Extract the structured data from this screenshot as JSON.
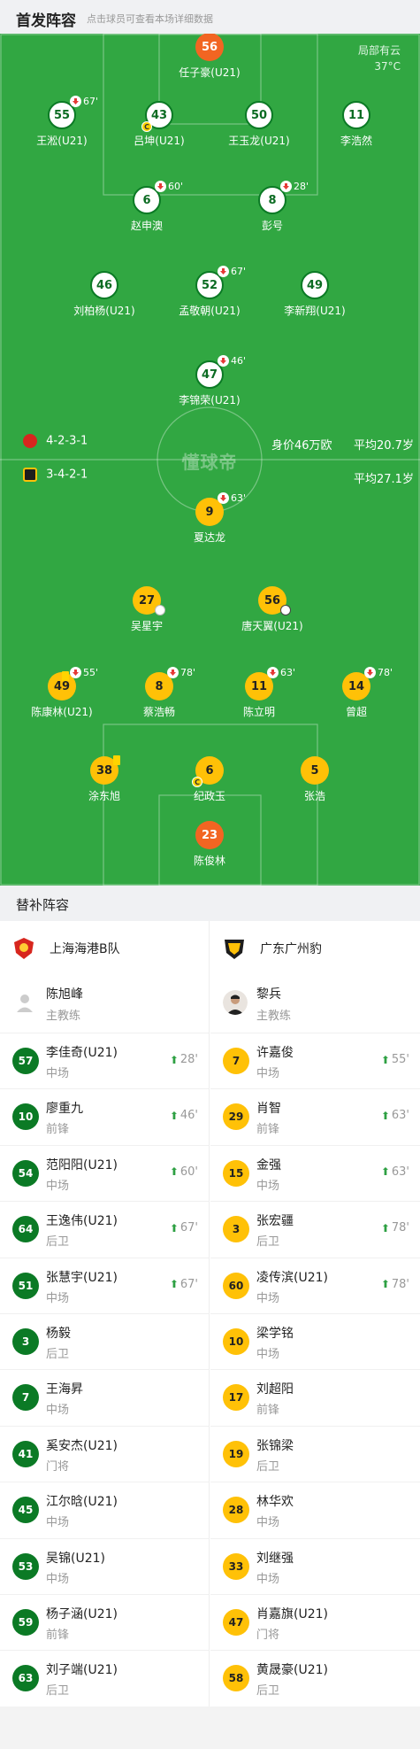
{
  "header": {
    "title": "首发阵容",
    "subtitle": "点击球员可查看本场详细数据"
  },
  "weather": {
    "line1": "局部有云",
    "line2": "37°C"
  },
  "pitch": {
    "watermark": "懂球帝",
    "home_formation": "4-2-3-1",
    "home_value": "身价46万欧",
    "home_avg_age": "平均20.7岁",
    "away_formation": "3-4-2-1",
    "away_avg_age": "平均27.1岁",
    "players": [
      {
        "num": "56",
        "name": "任子豪(U21)",
        "side": "gk-home"
      },
      {
        "num": "55",
        "name": "王淞(U21)",
        "side": "home",
        "sub": "67'"
      },
      {
        "num": "43",
        "name": "吕坤(U21)",
        "side": "home",
        "captain": "C"
      },
      {
        "num": "50",
        "name": "王玉龙(U21)",
        "side": "home"
      },
      {
        "num": "11",
        "name": "李浩然",
        "side": "home"
      },
      {
        "num": "6",
        "name": "赵申澳",
        "side": "home",
        "sub": "60'"
      },
      {
        "num": "8",
        "name": "彭号",
        "side": "home",
        "sub": "28'"
      },
      {
        "num": "46",
        "name": "刘柏杨(U21)",
        "side": "home"
      },
      {
        "num": "52",
        "name": "孟敬朝(U21)",
        "side": "home",
        "sub": "67'"
      },
      {
        "num": "49",
        "name": "李新翔(U21)",
        "side": "home"
      },
      {
        "num": "47",
        "name": "李锦荣(U21)",
        "side": "home",
        "sub": "46'"
      },
      {
        "num": "9",
        "name": "夏达龙",
        "side": "away",
        "sub": "63'"
      },
      {
        "num": "27",
        "name": "吴星宇",
        "side": "away",
        "event": "assist"
      },
      {
        "num": "56",
        "name": "唐天翼(U21)",
        "side": "away",
        "event": "goal"
      },
      {
        "num": "49",
        "name": "陈康林(U21)",
        "side": "away",
        "sub": "55'",
        "yellow": true
      },
      {
        "num": "8",
        "name": "蔡浩畅",
        "side": "away",
        "sub": "78'"
      },
      {
        "num": "11",
        "name": "陈立明",
        "side": "away",
        "sub": "63'"
      },
      {
        "num": "14",
        "name": "曾超",
        "side": "away",
        "sub": "78'"
      },
      {
        "num": "38",
        "name": "涂东旭",
        "side": "away",
        "yellow": true
      },
      {
        "num": "6",
        "name": "纪政玉",
        "side": "away",
        "captain": "C"
      },
      {
        "num": "5",
        "name": "张浩",
        "side": "away"
      },
      {
        "num": "23",
        "name": "陈俊林",
        "side": "gk-away"
      }
    ]
  },
  "bench": {
    "title": "替补阵容",
    "home": {
      "team": "上海海港B队",
      "coach": "陈旭峰",
      "coach_role": "主教练",
      "players": [
        {
          "num": "57",
          "name": "李佳奇(U21)",
          "pos": "中场",
          "time": "28'"
        },
        {
          "num": "10",
          "name": "廖重九",
          "pos": "前锋",
          "time": "46'"
        },
        {
          "num": "54",
          "name": "范阳阳(U21)",
          "pos": "中场",
          "time": "60'"
        },
        {
          "num": "64",
          "name": "王逸伟(U21)",
          "pos": "后卫",
          "time": "67'"
        },
        {
          "num": "51",
          "name": "张慧宇(U21)",
          "pos": "中场",
          "time": "67'"
        },
        {
          "num": "3",
          "name": "杨毅",
          "pos": "后卫",
          "time": ""
        },
        {
          "num": "7",
          "name": "王海昇",
          "pos": "中场",
          "time": ""
        },
        {
          "num": "41",
          "name": "奚安杰(U21)",
          "pos": "门将",
          "time": ""
        },
        {
          "num": "45",
          "name": "江尔晗(U21)",
          "pos": "中场",
          "time": ""
        },
        {
          "num": "53",
          "name": "吴锦(U21)",
          "pos": "中场",
          "time": ""
        },
        {
          "num": "59",
          "name": "杨子涵(U21)",
          "pos": "前锋",
          "time": ""
        },
        {
          "num": "63",
          "name": "刘子端(U21)",
          "pos": "后卫",
          "time": ""
        }
      ]
    },
    "away": {
      "team": "广东广州豹",
      "coach": "黎兵",
      "coach_role": "主教练",
      "players": [
        {
          "num": "7",
          "name": "许嘉俊",
          "pos": "中场",
          "time": "55'"
        },
        {
          "num": "29",
          "name": "肖智",
          "pos": "前锋",
          "time": "63'"
        },
        {
          "num": "15",
          "name": "金强",
          "pos": "中场",
          "time": "63'"
        },
        {
          "num": "3",
          "name": "张宏疆",
          "pos": "后卫",
          "time": "78'"
        },
        {
          "num": "60",
          "name": "凌传滨(U21)",
          "pos": "中场",
          "time": "78'"
        },
        {
          "num": "10",
          "name": "梁学铭",
          "pos": "中场",
          "time": ""
        },
        {
          "num": "17",
          "name": "刘超阳",
          "pos": "前锋",
          "time": ""
        },
        {
          "num": "19",
          "name": "张锦梁",
          "pos": "后卫",
          "time": ""
        },
        {
          "num": "28",
          "name": "林华欢",
          "pos": "中场",
          "time": ""
        },
        {
          "num": "33",
          "name": "刘继强",
          "pos": "中场",
          "time": ""
        },
        {
          "num": "47",
          "name": "肖嘉旗(U21)",
          "pos": "门将",
          "time": ""
        },
        {
          "num": "58",
          "name": "黄晟豪(U21)",
          "pos": "后卫",
          "time": ""
        }
      ]
    }
  }
}
